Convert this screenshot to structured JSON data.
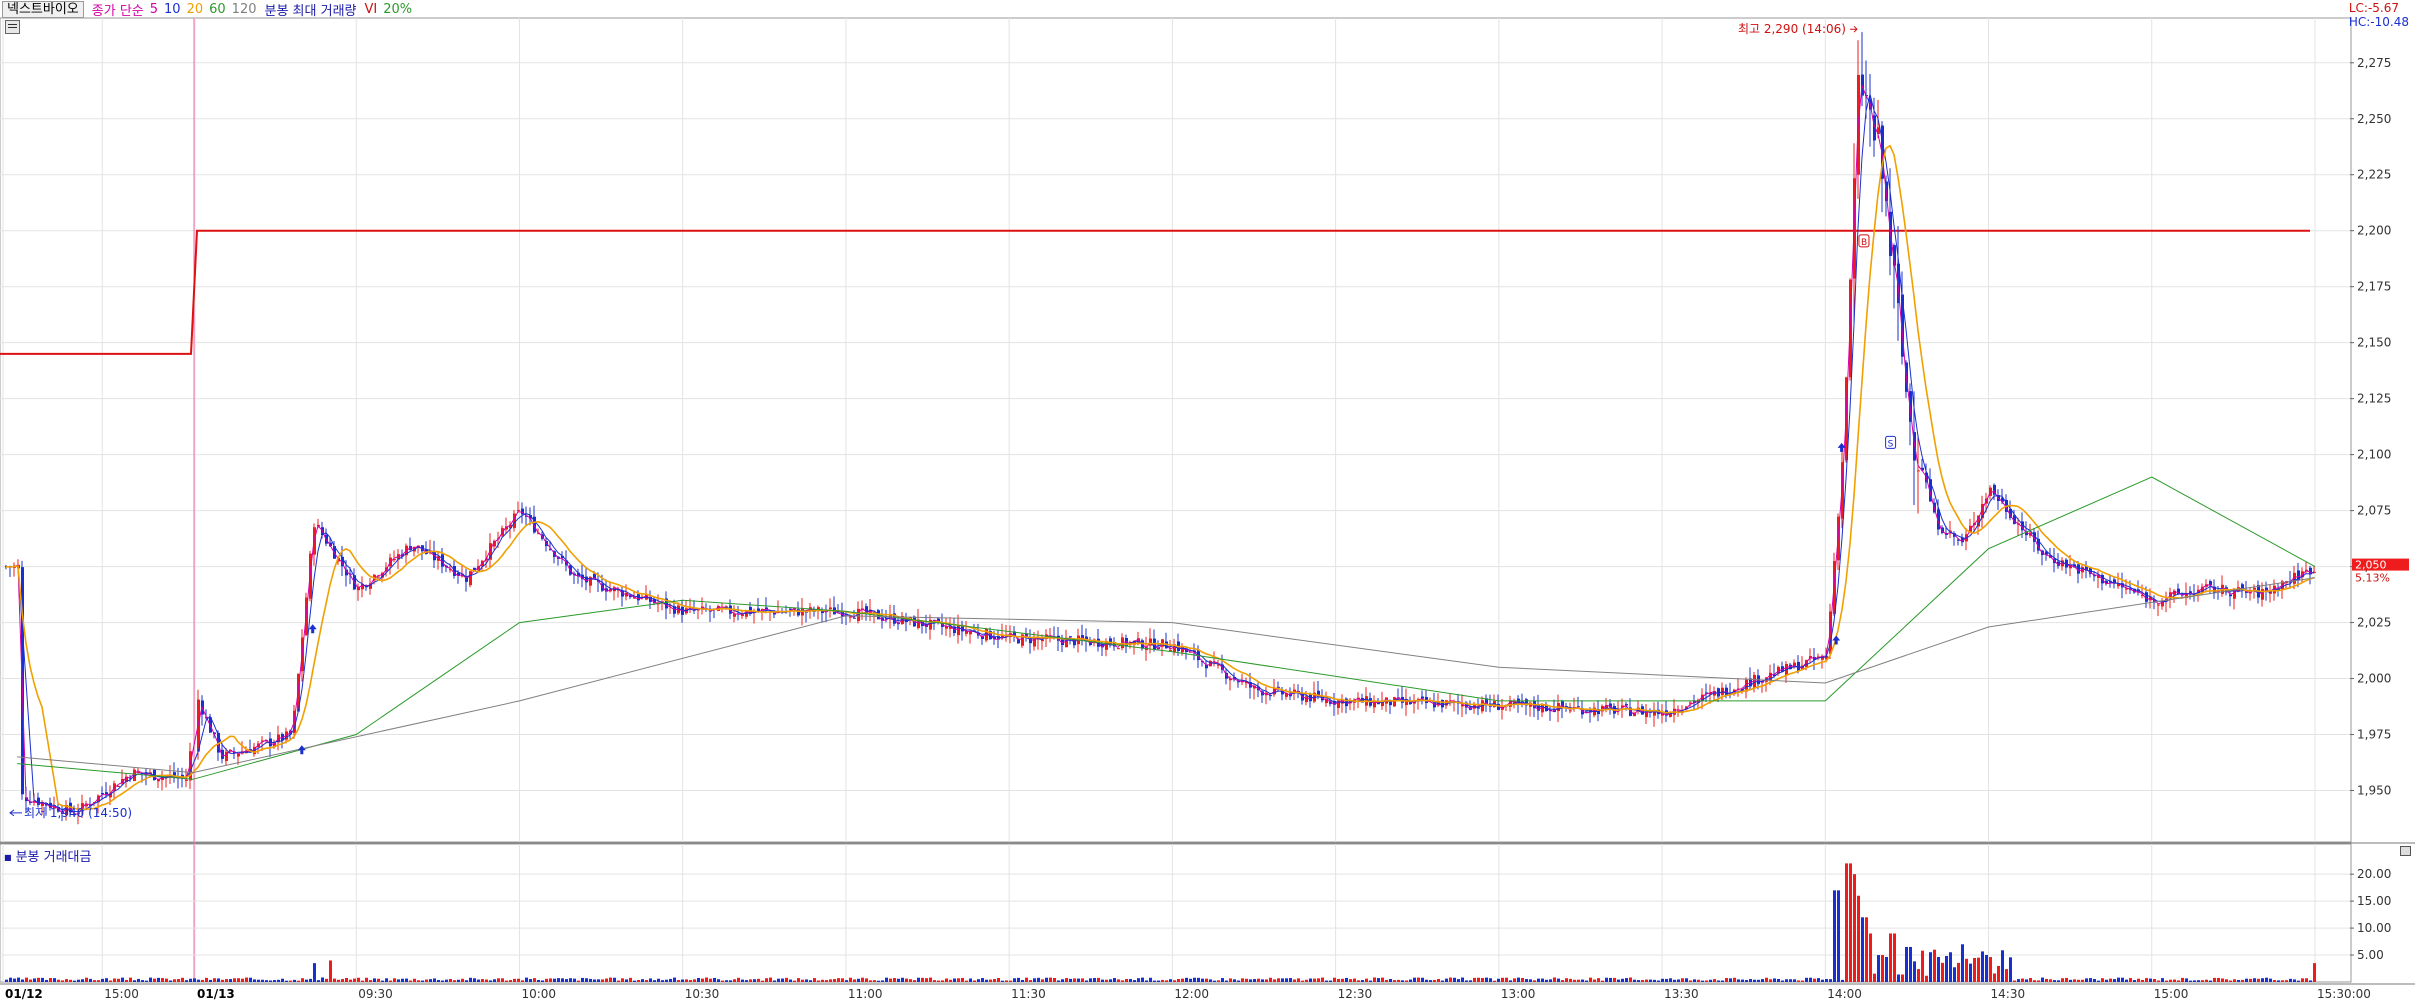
{
  "header": {
    "stock_name": "넥스트바이오",
    "legend_close_ma": "종가 단순",
    "ma_periods": [
      {
        "label": "5",
        "color": "#d400a8"
      },
      {
        "label": "10",
        "color": "#1a2fd0"
      },
      {
        "label": "20",
        "color": "#f0a000"
      },
      {
        "label": "60",
        "color": "#2a9a2a"
      },
      {
        "label": "120",
        "color": "#808080"
      }
    ],
    "legend_max_volume": "분봉 최대 거래량",
    "vi_label": "VI",
    "vi_value": "20%",
    "lc_label": "LC:-5.67",
    "hc_label": "HC:-10.48"
  },
  "volume_panel": {
    "legend": "분봉 거래대금"
  },
  "colors": {
    "up": "#ee1c1c",
    "down": "#1a2fd0",
    "grid": "#e3e3e3",
    "vi_line": "#dd1111",
    "axis_text": "#333333"
  },
  "chart_data": [
    {
      "type": "candlestick",
      "title": "넥스트바이오",
      "y_ticks": [
        1950,
        1975,
        2000,
        2025,
        2050,
        2075,
        2100,
        2125,
        2150,
        2175,
        2200,
        2225,
        2250,
        2275
      ],
      "y_tick_labels": [
        "1,950",
        "1,975",
        "2,000",
        "2,025",
        "2,050",
        "2,075",
        "2,100",
        "2,125",
        "2,150",
        "2,175",
        "2,200",
        "2,225",
        "2,250",
        "2,275"
      ],
      "ylim": [
        1927,
        2295
      ],
      "x_tick_labels": [
        {
          "label": "01/12",
          "at": "01/12",
          "bold": true
        },
        {
          "label": "15:00",
          "at": "15:00"
        },
        {
          "label": "01/13",
          "at": "01/13",
          "bold": true
        },
        {
          "label": "09:30",
          "at": "09:30"
        },
        {
          "label": "10:00",
          "at": "10:00"
        },
        {
          "label": "10:30",
          "at": "10:30"
        },
        {
          "label": "11:00",
          "at": "11:00"
        },
        {
          "label": "11:30",
          "at": "11:30"
        },
        {
          "label": "12:00",
          "at": "12:00"
        },
        {
          "label": "12:30",
          "at": "12:30"
        },
        {
          "label": "13:00",
          "at": "13:00"
        },
        {
          "label": "13:30",
          "at": "13:30"
        },
        {
          "label": "14:00",
          "at": "14:00"
        },
        {
          "label": "14:30",
          "at": "14:30"
        },
        {
          "label": "15:00",
          "at": "15:00 (01/13)"
        },
        {
          "label": "15:30:00",
          "at": "15:30"
        }
      ],
      "vi_levels": [
        {
          "period": "01/12",
          "price": 2145
        },
        {
          "period": "01/13",
          "price": 2200
        }
      ],
      "current_price": {
        "label": "2,050",
        "change_label": "5.13%",
        "price": 2050
      },
      "annotations": [
        {
          "text": "최고 2,290 (14:06)",
          "price": 2290,
          "time": "14:06"
        },
        {
          "text": "최저 1,940 (14:50)",
          "price": 1940,
          "time": "14:50 (01/12)"
        }
      ],
      "signal_markers": [
        {
          "text": "B",
          "time": "14:06"
        },
        {
          "text": "S",
          "time": "14:12"
        }
      ],
      "price_path": [
        [
          "01/12 14:30",
          1948
        ],
        [
          "01/12 14:50",
          1940
        ],
        [
          "01/12 15:10",
          1958
        ],
        [
          "01/12 15:30",
          1955
        ],
        [
          "01/13 09:00",
          1995
        ],
        [
          "01/13 09:05",
          1965
        ],
        [
          "01/13 09:12",
          1970
        ],
        [
          "01/13 09:18",
          1975
        ],
        [
          "01/13 09:22",
          2070
        ],
        [
          "01/13 09:30",
          2040
        ],
        [
          "01/13 09:40",
          2060
        ],
        [
          "01/13 09:50",
          2045
        ],
        [
          "01/13 10:00",
          2075
        ],
        [
          "01/13 10:10",
          2045
        ],
        [
          "01/13 10:30",
          2030
        ],
        [
          "01/13 11:00",
          2030
        ],
        [
          "01/13 11:30",
          2018
        ],
        [
          "01/13 12:00",
          2015
        ],
        [
          "01/13 12:15",
          1995
        ],
        [
          "01/13 12:30",
          1990
        ],
        [
          "01/13 13:00",
          1988
        ],
        [
          "01/13 13:30",
          1985
        ],
        [
          "01/13 13:45",
          1998
        ],
        [
          "01/13 14:00",
          2010
        ],
        [
          "01/13 14:03",
          2100
        ],
        [
          "01/13 14:06",
          2270
        ],
        [
          "01/13 14:10",
          2230
        ],
        [
          "01/13 14:15",
          2120
        ],
        [
          "01/13 14:20",
          2070
        ],
        [
          "01/13 14:25",
          2060
        ],
        [
          "01/13 14:30",
          2085
        ],
        [
          "01/13 14:40",
          2055
        ],
        [
          "01/13 14:50",
          2045
        ],
        [
          "01/13 15:00",
          2035
        ],
        [
          "01/13 15:10",
          2040
        ],
        [
          "01/13 15:20",
          2038
        ],
        [
          "01/13 15:30",
          2050
        ]
      ],
      "ma60_path": [
        [
          "01/12 14:30",
          1962
        ],
        [
          "01/13 09:00",
          1955
        ],
        [
          "01/13 09:30",
          1975
        ],
        [
          "01/13 10:00",
          2025
        ],
        [
          "01/13 10:30",
          2035
        ],
        [
          "01/13 11:00",
          2030
        ],
        [
          "01/13 12:00",
          2012
        ],
        [
          "01/13 13:00",
          1990
        ],
        [
          "01/13 14:00",
          1990
        ],
        [
          "01/13 14:30",
          2058
        ],
        [
          "01/13 15:00",
          2090
        ],
        [
          "01/13 15:30",
          2050
        ]
      ],
      "ma120_path": [
        [
          "01/12 14:30",
          1965
        ],
        [
          "01/13 09:00",
          1958
        ],
        [
          "01/13 10:00",
          1990
        ],
        [
          "01/13 11:00",
          2028
        ],
        [
          "01/13 12:00",
          2025
        ],
        [
          "01/13 13:00",
          2005
        ],
        [
          "01/13 14:00",
          1998
        ],
        [
          "01/13 14:30",
          2023
        ],
        [
          "01/13 15:30",
          2045
        ]
      ]
    },
    {
      "type": "bar",
      "title": "분봉 거래대금",
      "y_ticks": [
        5,
        10,
        15,
        20
      ],
      "y_tick_labels": [
        "5.00",
        "10.00",
        "15.00",
        "20.00"
      ],
      "ylim": [
        0,
        23
      ],
      "spikes": [
        {
          "time": "09:22",
          "value": 3.5
        },
        {
          "time": "09:25",
          "value": 4.0
        },
        {
          "time": "14:02",
          "value": 17.0
        },
        {
          "time": "14:04",
          "value": 22.0
        },
        {
          "time": "14:05",
          "value": 20.0
        },
        {
          "time": "14:06",
          "value": 16.0
        },
        {
          "time": "14:07",
          "value": 12.0
        },
        {
          "time": "14:08",
          "value": 9.0
        },
        {
          "time": "14:10",
          "value": 5.0
        },
        {
          "time": "14:12",
          "value": 9.0
        },
        {
          "time": "14:15",
          "value": 6.5
        },
        {
          "time": "14:25",
          "value": 7.0
        },
        {
          "time": "15:30",
          "value": 3.5
        }
      ],
      "baseline_typical": 0.6
    }
  ]
}
